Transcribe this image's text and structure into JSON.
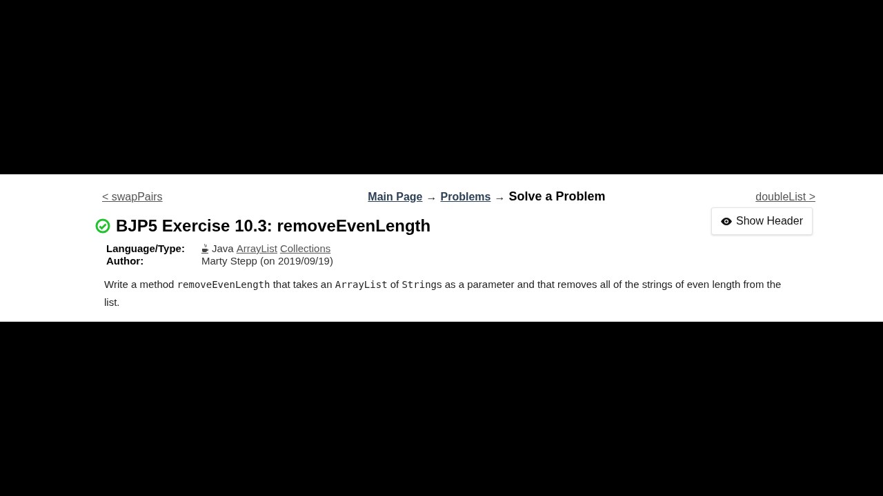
{
  "nav": {
    "prev": "< swapPairs",
    "next": "doubleList >",
    "breadcrumb": [
      {
        "label": "Main Page",
        "link": true
      },
      {
        "label": "→",
        "link": false
      },
      {
        "label": "Problems",
        "link": true
      },
      {
        "label": "→",
        "link": false
      },
      {
        "label": "Solve a Problem",
        "link": false
      }
    ]
  },
  "show_header_button": "Show Header",
  "problem": {
    "solved": true,
    "title": "BJP5 Exercise 10.3: removeEvenLength",
    "meta": [
      {
        "label": "Language/Type:",
        "parts": [
          {
            "kind": "icon"
          },
          {
            "kind": "text",
            "text": "Java"
          },
          {
            "kind": "link",
            "text": "ArrayList"
          },
          {
            "kind": "link",
            "text": "Collections"
          }
        ]
      },
      {
        "label": "Author:",
        "parts": [
          {
            "kind": "text",
            "text": "Marty Stepp (on 2019/09/19)"
          }
        ]
      }
    ],
    "description": [
      {
        "code": false,
        "text": "Write a method "
      },
      {
        "code": true,
        "text": "removeEvenLength"
      },
      {
        "code": false,
        "text": " that takes an "
      },
      {
        "code": true,
        "text": "ArrayList"
      },
      {
        "code": false,
        "text": " of "
      },
      {
        "code": true,
        "text": "String"
      },
      {
        "code": false,
        "text": "s as a parameter and that removes all of the strings of even length from the list."
      }
    ]
  }
}
